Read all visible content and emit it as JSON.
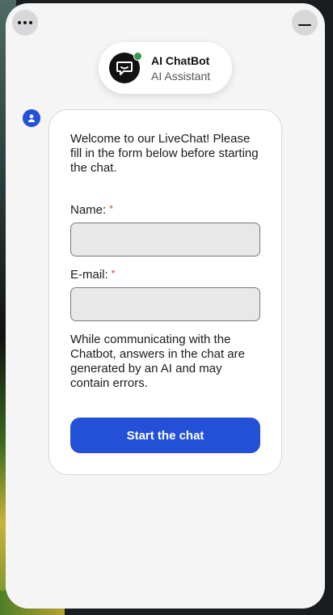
{
  "header": {
    "bot_name": "AI ChatBot",
    "bot_subtitle": "AI Assistant",
    "status_color": "#3a9a4b"
  },
  "icons": {
    "menu": "more-horizontal-icon",
    "minimize": "minimize-icon",
    "bot": "chat-bubble-icon",
    "user": "user-icon"
  },
  "form": {
    "intro": "Welcome to our LiveChat! Please fill in the form below before starting the chat.",
    "name_label": "Name:",
    "email_label": "E-mail:",
    "required_marker": "*",
    "name_value": "",
    "email_value": "",
    "disclaimer": "While communicating with the Chatbot, answers in the chat are generated by an AI and may contain errors.",
    "submit_label": "Start the chat"
  },
  "colors": {
    "accent": "#2350d6",
    "required": "#d23a2a"
  }
}
